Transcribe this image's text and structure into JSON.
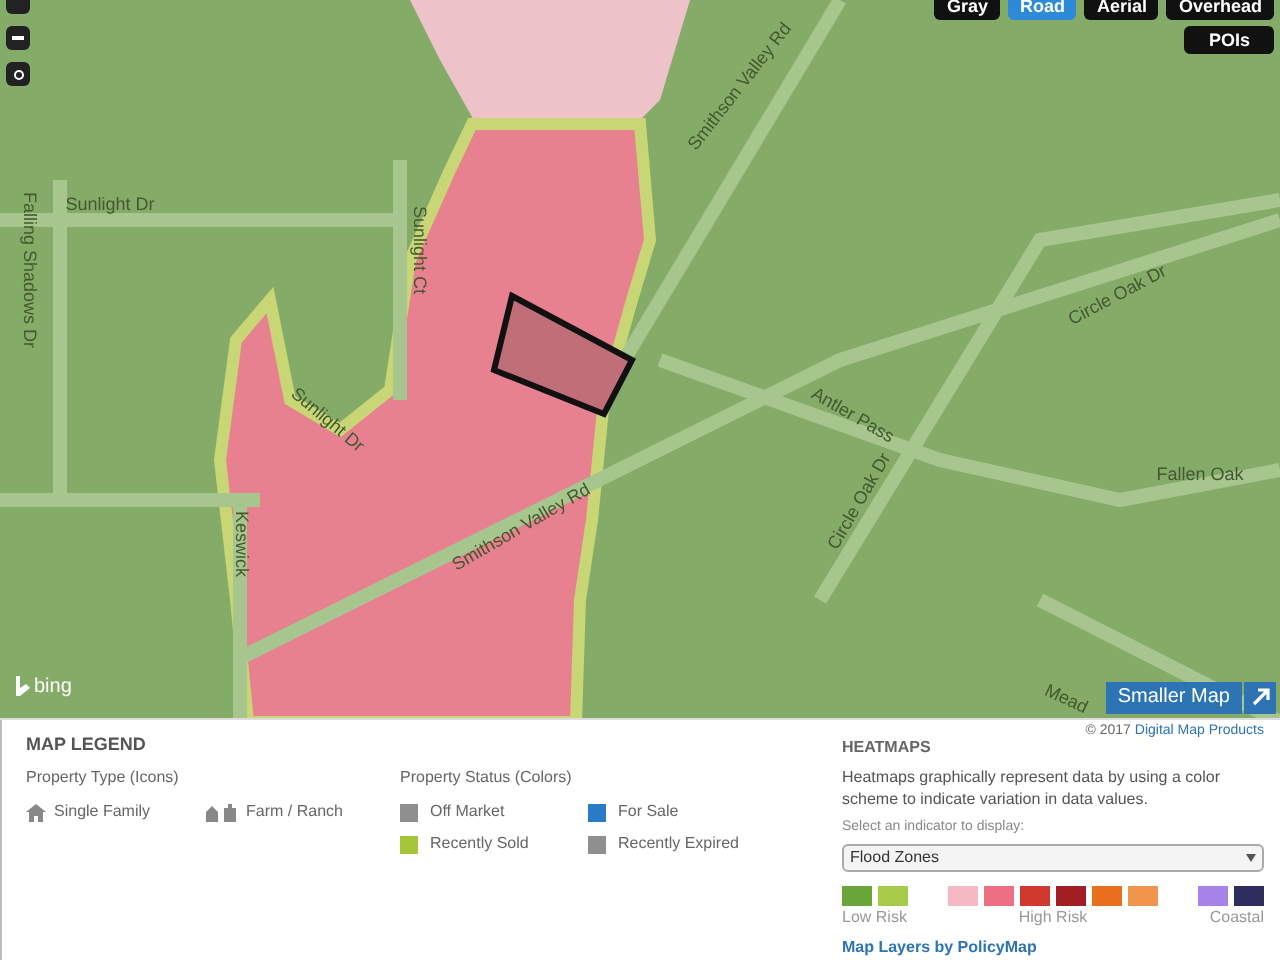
{
  "map": {
    "layer_buttons": [
      {
        "label": "Gray",
        "selected": false
      },
      {
        "label": "Road",
        "selected": true
      },
      {
        "label": "Aerial",
        "selected": false
      },
      {
        "label": "Overhead",
        "selected": false
      }
    ],
    "pois_button": "POIs",
    "streets": [
      "Smithson Valley Rd",
      "Sunlight Dr",
      "Falling Shadows Dr",
      "Sunlight Ct",
      "Circle Oak Dr",
      "Antler Pass",
      "Fallen Oak",
      "Circle Oak Dr",
      "Sunlight Dr",
      "Smithson Valley Rd",
      "Keswick",
      "Mead"
    ],
    "logo": "bing",
    "copyright": "© 2017",
    "copyright_link": "Digital Map Products",
    "smaller_map_button": "Smaller Map"
  },
  "legend": {
    "title": "MAP LEGEND",
    "type_heading": "Property Type (Icons)",
    "types": [
      {
        "label": "Single Family",
        "kind": "house"
      },
      {
        "label": "Farm / Ranch",
        "kind": "farm"
      }
    ],
    "status_heading": "Property Status (Colors)",
    "statuses": [
      {
        "label": "Off Market",
        "color": "#8f8f8f"
      },
      {
        "label": "For Sale",
        "color": "#2a7cc7"
      },
      {
        "label": "Recently Sold",
        "color": "#a6c63a"
      },
      {
        "label": "Recently Expired",
        "color": "#8f8f8f"
      }
    ]
  },
  "heatmaps": {
    "title": "HEATMAPS",
    "description": "Heatmaps graphically represent data by using a color scheme to indicate variation in data values.",
    "select_label": "Select an indicator to display:",
    "select_value": "Flood Zones",
    "swatches": [
      {
        "color": "#6aa53a"
      },
      {
        "color": "#a8cc4a"
      },
      {
        "color": "#f5b8c4"
      },
      {
        "color": "#ec6f84"
      },
      {
        "color": "#d03a2e"
      },
      {
        "color": "#a01e24"
      },
      {
        "color": "#e8701d"
      },
      {
        "color": "#f0954b"
      },
      {
        "color": "#a583e8"
      },
      {
        "color": "#2f2c5e"
      }
    ],
    "scale_labels": [
      "Low Risk",
      "High Risk",
      "Coastal"
    ],
    "footer_link": "Map Layers by PolicyMap"
  }
}
